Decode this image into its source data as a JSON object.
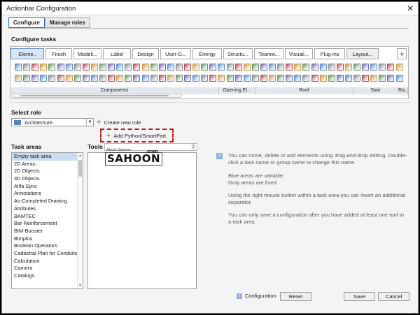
{
  "window": {
    "title": "Actionbar Configuration",
    "close_glyph": "✕"
  },
  "tabs": [
    {
      "label": "Configure"
    },
    {
      "label": "Manage roles"
    }
  ],
  "configure_tasks": {
    "label": "Configure tasks",
    "categories": [
      "Eleme..",
      "Finish",
      "Modeli...",
      "Label",
      "Design",
      "User-D...",
      "Energy",
      "Structu...",
      "Teamw...",
      "Visuali...",
      "Plug-ins",
      "Layout..."
    ],
    "add_glyph": "+",
    "groups": [
      "Components",
      "Opening El...",
      "Roof",
      "Stair",
      "Ra.."
    ]
  },
  "select_role": {
    "label": "Select role",
    "selected": "Architecture",
    "create_label": "Create new role",
    "add_python_label": "Add Python/SmartPart"
  },
  "task_areas": {
    "label": "Task areas",
    "items": [
      "Empty task area",
      "2D Areas",
      "2D Objects",
      "3D Objects",
      "Allfa Sync",
      "Annotations",
      "As-Completed Drawing",
      "Attributes",
      "BAMTEC",
      "Bar Reinforcement",
      "BIM-Booster",
      "Bimplus",
      "Boolean Operators",
      "Cadastral Plan for Conduits",
      "Calculation",
      "Camera",
      "Catalogs"
    ]
  },
  "tools": {
    "label": "Tools",
    "search_value": ""
  },
  "watermark": {
    "small_label": "About Sahoon",
    "brand": "SAHOON",
    "suffix": ".com"
  },
  "info": {
    "paragraphs": [
      "You can move, delete or add elements using drag-and-drop editing. Double-click a task name or group name to change this name.",
      "Blue areas are variable.\nGray areas are fixed.",
      "Using the right mouse button within a task area you can insert an additional separator.",
      "You can only save a configuration after you have added at least one tool to a task area."
    ]
  },
  "footer": {
    "configuration_label": "Configuration",
    "reset_label": "Reset",
    "save_label": "Save",
    "cancel_label": "Cancel"
  },
  "colors": {
    "accent": "#2c6fb7",
    "highlight_dash": "#c4171c",
    "selection": "#c9dcf1"
  }
}
